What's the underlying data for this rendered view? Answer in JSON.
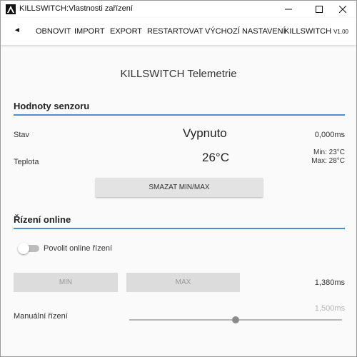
{
  "window": {
    "title": "KILLSWITCH:Vlastnosti zařízení",
    "controls": {
      "minimize": "minimize-icon",
      "maximize": "maximize-icon",
      "close": "close-icon"
    }
  },
  "toolbar": {
    "back_icon": "◄",
    "refresh": "OBNOVIT",
    "import": "IMPORT",
    "export": "EXPORT",
    "restart": "RESTARTOVAT",
    "defaults": "VÝCHOZÍ NASTAVENÍ",
    "device": "KILLSWITCH",
    "version": "V1.00"
  },
  "page": {
    "heading": "KILLSWITCH Telemetrie"
  },
  "sensors": {
    "section_title": "Hodnoty senzoru",
    "status_label": "Stav",
    "status_value": "Vypnuto",
    "status_time": "0,000ms",
    "temp_label": "Teplota",
    "temp_value": "26°C",
    "temp_min": "Min: 23°C",
    "temp_max": "Max: 28°C",
    "clear_button": "SMAZAT MIN/MAX"
  },
  "online": {
    "section_title": "Řízení online",
    "toggle_label": "Povolit online řízení",
    "toggle_on": false,
    "min_button": "MIN",
    "max_button": "MAX",
    "current_value": "1,380ms",
    "manual_label": "Manuální řízení",
    "slider_value": "1,500ms",
    "slider_fraction": 0.5
  },
  "colors": {
    "accent_line": "#4a8fd6",
    "disabled_button": "#dcdcdc"
  }
}
